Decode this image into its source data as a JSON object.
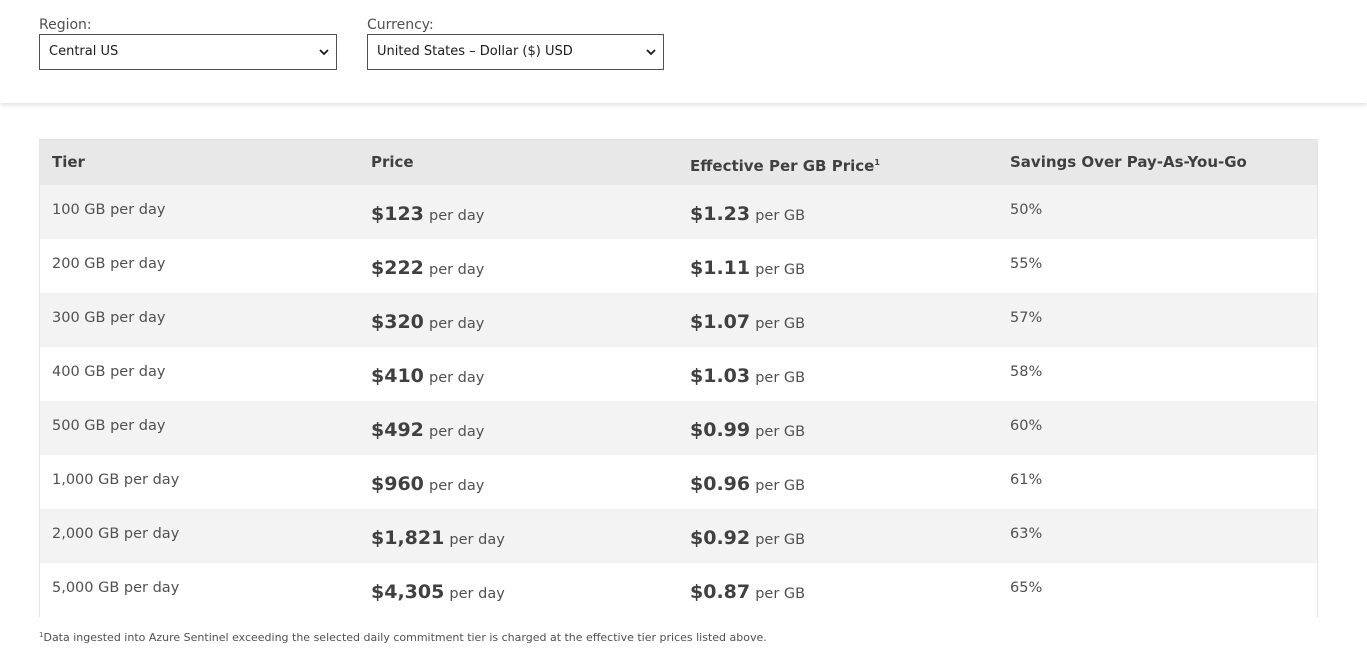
{
  "filters": {
    "region": {
      "label": "Region:",
      "value": "Central US"
    },
    "currency": {
      "label": "Currency:",
      "value": "United States – Dollar ($) USD"
    }
  },
  "table": {
    "headers": {
      "tier": "Tier",
      "price": "Price",
      "effective": "Effective Per GB Price",
      "effective_sup": "1",
      "savings": "Savings Over Pay-As-You-Go"
    },
    "rows": [
      {
        "tier": "100 GB per day",
        "price": "$123",
        "price_unit": "per day",
        "effective": "$1.23",
        "effective_unit": "per GB",
        "savings": "50%"
      },
      {
        "tier": "200 GB per day",
        "price": "$222",
        "price_unit": "per day",
        "effective": "$1.11",
        "effective_unit": "per GB",
        "savings": "55%"
      },
      {
        "tier": "300 GB per day",
        "price": "$320",
        "price_unit": "per day",
        "effective": "$1.07",
        "effective_unit": "per GB",
        "savings": "57%"
      },
      {
        "tier": "400 GB per day",
        "price": "$410",
        "price_unit": "per day",
        "effective": "$1.03",
        "effective_unit": "per GB",
        "savings": "58%"
      },
      {
        "tier": "500 GB per day",
        "price": "$492",
        "price_unit": "per day",
        "effective": "$0.99",
        "effective_unit": "per GB",
        "savings": "60%"
      },
      {
        "tier": "1,000 GB per day",
        "price": "$960",
        "price_unit": "per day",
        "effective": "$0.96",
        "effective_unit": "per GB",
        "savings": "61%"
      },
      {
        "tier": "2,000 GB per day",
        "price": "$1,821",
        "price_unit": "per day",
        "effective": "$0.92",
        "effective_unit": "per GB",
        "savings": "63%"
      },
      {
        "tier": "5,000 GB per day",
        "price": "$4,305",
        "price_unit": "per day",
        "effective": "$0.87",
        "effective_unit": "per GB",
        "savings": "65%"
      }
    ]
  },
  "footnote": {
    "marker": "1",
    "text": "Data ingested into Azure Sentinel exceeding the selected daily commitment tier is charged at the effective tier prices listed above."
  },
  "icons": {
    "select_chevron": "chevron-down-icon"
  }
}
